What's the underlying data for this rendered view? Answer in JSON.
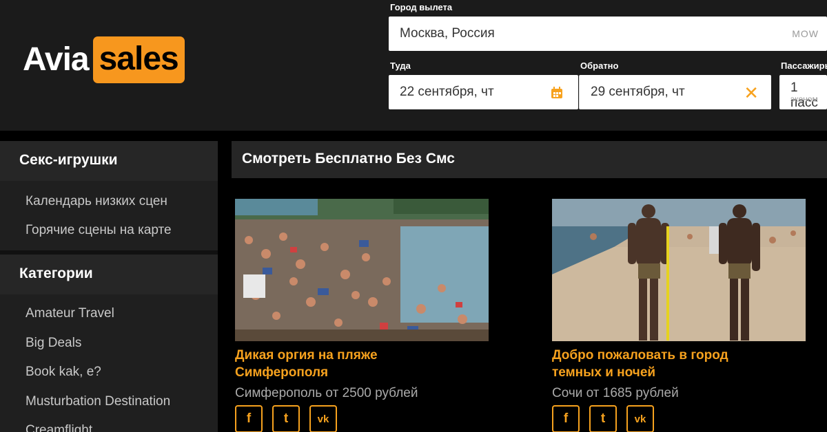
{
  "logo": {
    "part1": "Avia",
    "part2": "sales"
  },
  "search": {
    "origin_label": "Город вылета",
    "origin_value": "Москва, Россия",
    "origin_code": "MOW",
    "depart_label": "Туда",
    "depart_value": "22 сентября, чт",
    "return_label": "Обратно",
    "return_value": "29 сентября, чт",
    "passengers_label": "Пассажиры",
    "passengers_value": "1 пасс",
    "passengers_class": "эконом"
  },
  "sidebar": {
    "section1_title": "Секс-игрушки",
    "section1_items": [
      "Календарь низких сцен",
      "Горячие сцены на карте"
    ],
    "section2_title": "Категории",
    "section2_items": [
      "Amateur Travel",
      "Big Deals",
      "Book kak, e?",
      "Musturbation Destination",
      "Creamflight"
    ]
  },
  "content": {
    "heading": "Смотреть Бесплатно Без Смс",
    "cards": [
      {
        "title_line1": "Дикая оргия на пляже",
        "title_line2": "Симферополя",
        "subtitle": "Симферополь от 2500 рублей"
      },
      {
        "title_line1": "Добро пожаловать в город",
        "title_line2": "темных и ночей",
        "subtitle": "Сочи от 1685 рублей"
      }
    ],
    "social": [
      "f",
      "t",
      "vk"
    ]
  },
  "colors": {
    "accent": "#f7a21e",
    "header_bg": "#1b1b1b",
    "panel_bg": "#262626"
  }
}
